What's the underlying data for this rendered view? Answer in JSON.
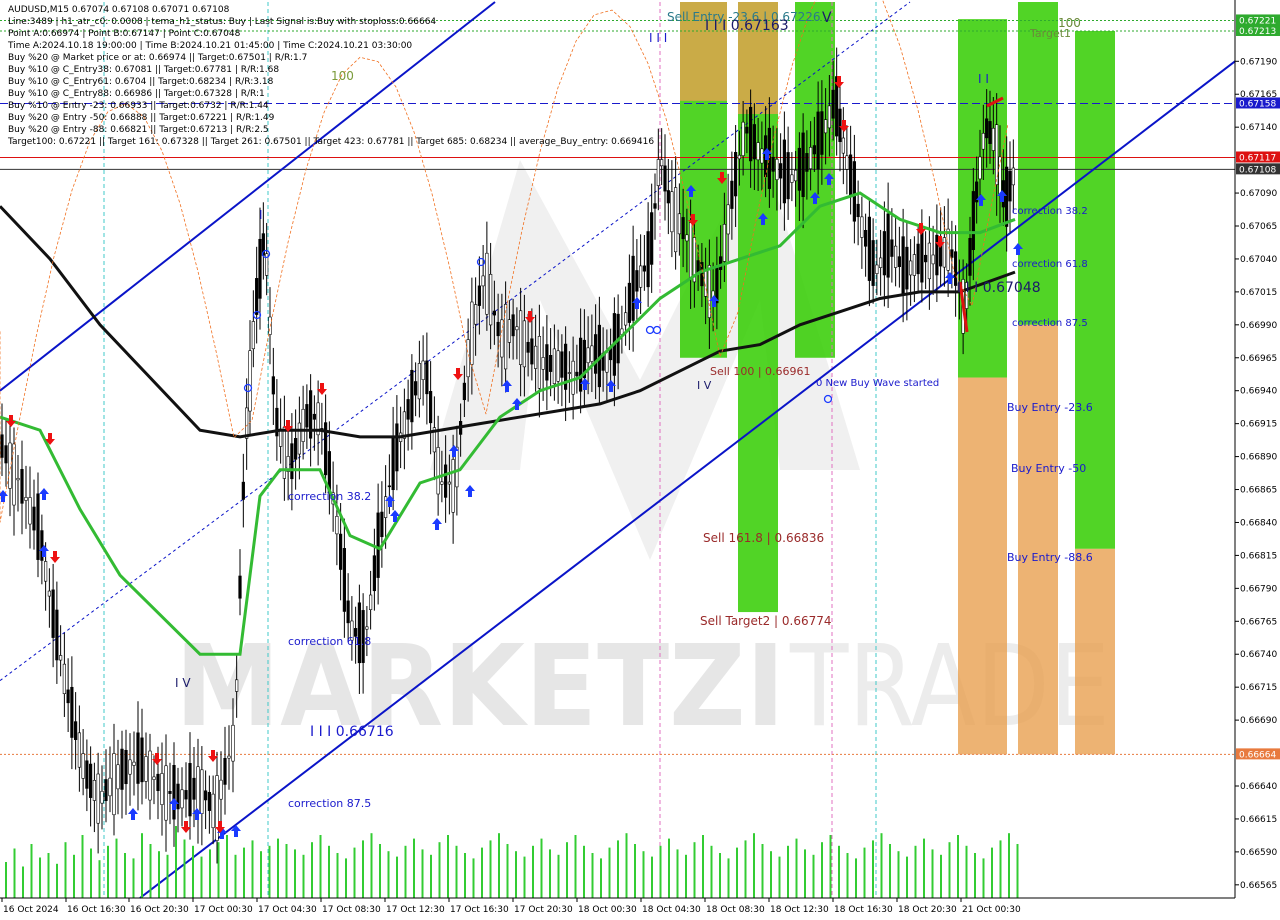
{
  "header": {
    "lines": [
      "AUDUSD,M15  0.67074 0.67108 0.67071 0.67108",
      "Line:3489 | h1_atr_c0: 0.0008 | tema_h1_status: Buy | Last Signal is:Buy with stoploss:0.66664",
      "Point A:0.66974 | Point B:0.67147 | Point C:0.67048",
      "Time A:2024.10.18 19:00:00 | Time B:2024.10.21 01:45:00 | Time C:2024.10.21 03:30:00",
      "Buy %20 @ Market price or at: 0.66974 || Target:0.67501 | R/R:1.7",
      "Buy %10 @ C_Entry38: 0.67081 || Target:0.67781 | R/R:1.68",
      "Buy %10 @ C_Entry61: 0.6704 || Target:0.68234 | R/R:3.18",
      "Buy %10 @ C_Entry88: 0.66986 || Target:0.67328 | R/R:1",
      "Buy %10 @ Entry -23: 0.66933 || Target:0.6732 | R/R:1.44",
      "Buy %20 @ Entry -50: 0.66888 || Target:0.67221 | R/R:1.49",
      "Buy %20 @ Entry -88: 0.66821 || Target:0.67213 | R/R:2.5",
      "Target100: 0.67221 || Target 161: 0.67328 || Target 261: 0.67501 || Target 423: 0.67781 || Target 685: 0.68234 || average_Buy_entry: 0.669416"
    ]
  },
  "axis": {
    "price_ticks": [
      "0.67190",
      "0.67165",
      "0.67140",
      "0.67090",
      "0.67065",
      "0.67040",
      "0.67015",
      "0.66990",
      "0.66965",
      "0.66940",
      "0.66915",
      "0.66890",
      "0.66865",
      "0.66840",
      "0.66815",
      "0.66790",
      "0.66765",
      "0.66740",
      "0.66715",
      "0.66690",
      "0.66640",
      "0.66615",
      "0.66590",
      "0.66565"
    ],
    "price_markers": [
      {
        "text": "0.67221",
        "color": "#2eaa2e"
      },
      {
        "text": "0.67213",
        "color": "#2eaa2e"
      },
      {
        "text": "0.67158",
        "color": "#1a1acc"
      },
      {
        "text": "0.67117",
        "color": "#dd1111"
      },
      {
        "text": "0.67108",
        "color": "#333333"
      },
      {
        "text": "0.66664",
        "color": "#e87a3e"
      }
    ],
    "time_labels": [
      "16 Oct 2024",
      "16 Oct 16:30",
      "16 Oct 20:30",
      "17 Oct 00:30",
      "17 Oct 04:30",
      "17 Oct 08:30",
      "17 Oct 12:30",
      "17 Oct 16:30",
      "17 Oct 20:30",
      "18 Oct 00:30",
      "18 Oct 04:30",
      "18 Oct 08:30",
      "18 Oct 12:30",
      "18 Oct 16:30",
      "18 Oct 20:30",
      "21 Oct 00:30"
    ]
  },
  "annotations": [
    {
      "text": "Sell Entry -23.6 | 0.67226",
      "color": "#2a7a8a"
    },
    {
      "text": "I I I 0.67163",
      "color": "#1a1a6a"
    },
    {
      "text": "Target1",
      "color": "#6a8a3a"
    },
    {
      "text": "100",
      "color": "#7a9a3a"
    },
    {
      "text": "100",
      "color": "#6a8a3a"
    },
    {
      "text": "Sell 100 | 0.66961",
      "color": "#9a2a2a"
    },
    {
      "text": "0 New Buy Wave started",
      "color": "#1a1acc"
    },
    {
      "text": "Sell 161.8 | 0.66836",
      "color": "#9a2a2a"
    },
    {
      "text": "Sell Target2 | 0.66774",
      "color": "#9a2a2a"
    },
    {
      "text": "correction 38.2",
      "color": "#1a1acc"
    },
    {
      "text": "correction 61.8",
      "color": "#1a1acc"
    },
    {
      "text": "correction 87.5",
      "color": "#1a1acc"
    },
    {
      "text": "I I I 0.67048",
      "color": "#1a1a6a"
    },
    {
      "text": "Buy Entry -23.6",
      "color": "#1a1acc"
    },
    {
      "text": "Buy Entry -50",
      "color": "#1a1acc"
    },
    {
      "text": "Buy Entry -88.6",
      "color": "#1a1acc"
    },
    {
      "text": "correction 38.2",
      "color": "#1a1acc"
    },
    {
      "text": "correction 61.8",
      "color": "#1a1acc"
    },
    {
      "text": "correction 87.5",
      "color": "#1a1acc"
    },
    {
      "text": "I I I 0.66716",
      "color": "#1a1acc"
    },
    {
      "text": "I V",
      "color": "#1a1a6a"
    },
    {
      "text": "V",
      "color": "#1a1a6a"
    },
    {
      "text": "I I I",
      "color": "#1a1acc"
    },
    {
      "text": "I V",
      "color": "#1a1a6a"
    },
    {
      "text": "I I",
      "color": "#1a1acc"
    },
    {
      "text": "I",
      "color": "#1a1acc"
    }
  ],
  "watermark": {
    "part1": "MARKETZI",
    "part2": "TRADE"
  },
  "colors": {
    "green_zone": "#33cc00",
    "orange_zone": "#e8a050",
    "channel": "#0a14c8",
    "ma_black": "#111111",
    "ma_green": "#33bb33",
    "volume": "#33cc33",
    "target_line": "#2eaa2e",
    "stop_line": "#e87a3e",
    "bull_candle": "#000000",
    "bear_candle": "#000000"
  },
  "chart_data": {
    "type": "candlestick",
    "symbol": "AUDUSD",
    "timeframe": "M15",
    "last_ohlc": {
      "open": 0.67074,
      "high": 0.67108,
      "low": 0.67071,
      "close": 0.67108
    },
    "ylim": [
      0.66555,
      0.67235
    ],
    "x_labels": [
      "16 Oct 2024",
      "16 Oct 16:30",
      "16 Oct 20:30",
      "17 Oct 00:30",
      "17 Oct 04:30",
      "17 Oct 08:30",
      "17 Oct 12:30",
      "17 Oct 16:30",
      "17 Oct 20:30",
      "18 Oct 00:30",
      "18 Oct 04:30",
      "18 Oct 08:30",
      "18 Oct 12:30",
      "18 Oct 16:30",
      "18 Oct 20:30",
      "21 Oct 00:30"
    ],
    "price_path": [
      [
        0,
        0.669
      ],
      [
        20,
        0.6687
      ],
      [
        40,
        0.6683
      ],
      [
        55,
        0.6676
      ],
      [
        70,
        0.667
      ],
      [
        85,
        0.6665
      ],
      [
        100,
        0.6663
      ],
      [
        120,
        0.6665
      ],
      [
        140,
        0.6666
      ],
      [
        160,
        0.6664
      ],
      [
        180,
        0.6663
      ],
      [
        200,
        0.6664
      ],
      [
        215,
        0.6662
      ],
      [
        235,
        0.6668
      ],
      [
        245,
        0.669
      ],
      [
        255,
        0.67
      ],
      [
        265,
        0.6706
      ],
      [
        275,
        0.6692
      ],
      [
        290,
        0.6688
      ],
      [
        305,
        0.6692
      ],
      [
        320,
        0.6692
      ],
      [
        335,
        0.6685
      ],
      [
        350,
        0.6676
      ],
      [
        365,
        0.6675
      ],
      [
        380,
        0.6683
      ],
      [
        395,
        0.6689
      ],
      [
        410,
        0.6693
      ],
      [
        425,
        0.6696
      ],
      [
        440,
        0.6687
      ],
      [
        455,
        0.6687
      ],
      [
        470,
        0.6698
      ],
      [
        485,
        0.6703
      ],
      [
        500,
        0.6698
      ],
      [
        515,
        0.6699
      ],
      [
        530,
        0.6697
      ],
      [
        545,
        0.6696
      ],
      [
        560,
        0.6696
      ],
      [
        575,
        0.6695
      ],
      [
        590,
        0.6697
      ],
      [
        605,
        0.6696
      ],
      [
        620,
        0.6698
      ],
      [
        635,
        0.6702
      ],
      [
        650,
        0.6704
      ],
      [
        660,
        0.6712
      ],
      [
        670,
        0.6708
      ],
      [
        685,
        0.6706
      ],
      [
        700,
        0.6703
      ],
      [
        715,
        0.6701
      ],
      [
        730,
        0.6708
      ],
      [
        745,
        0.6714
      ],
      [
        760,
        0.6712
      ],
      [
        775,
        0.6711
      ],
      [
        790,
        0.671
      ],
      [
        805,
        0.6711
      ],
      [
        820,
        0.6713
      ],
      [
        835,
        0.6716
      ],
      [
        845,
        0.6712
      ],
      [
        860,
        0.6707
      ],
      [
        875,
        0.6703
      ],
      [
        890,
        0.6705
      ],
      [
        905,
        0.6703
      ],
      [
        920,
        0.6704
      ],
      [
        935,
        0.6704
      ],
      [
        950,
        0.6705
      ],
      [
        965,
        0.67
      ],
      [
        975,
        0.6708
      ],
      [
        985,
        0.6714
      ],
      [
        995,
        0.6713
      ],
      [
        1005,
        0.6708
      ],
      [
        1015,
        0.67108
      ]
    ],
    "moving_averages": [
      {
        "name": "",
        "color": "#111111",
        "points": [
          [
            0,
            0.6708
          ],
          [
            50,
            0.6704
          ],
          [
            100,
            0.6699
          ],
          [
            150,
            0.6695
          ],
          [
            200,
            0.6691
          ],
          [
            240,
            0.66905
          ],
          [
            280,
            0.6691
          ],
          [
            320,
            0.6691
          ],
          [
            360,
            0.66905
          ],
          [
            400,
            0.66905
          ],
          [
            440,
            0.6691
          ],
          [
            480,
            0.66915
          ],
          [
            520,
            0.6692
          ],
          [
            560,
            0.66925
          ],
          [
            600,
            0.6693
          ],
          [
            640,
            0.6694
          ],
          [
            680,
            0.66955
          ],
          [
            720,
            0.6697
          ],
          [
            760,
            0.66975
          ],
          [
            800,
            0.6699
          ],
          [
            840,
            0.67
          ],
          [
            880,
            0.6701
          ],
          [
            920,
            0.67015
          ],
          [
            960,
            0.67015
          ],
          [
            1015,
            0.6703
          ]
        ]
      },
      {
        "name": "",
        "color": "#33bb33",
        "points": [
          [
            0,
            0.6692
          ],
          [
            40,
            0.6691
          ],
          [
            80,
            0.6685
          ],
          [
            120,
            0.668
          ],
          [
            160,
            0.6677
          ],
          [
            200,
            0.6674
          ],
          [
            240,
            0.6674
          ],
          [
            260,
            0.6686
          ],
          [
            280,
            0.6688
          ],
          [
            320,
            0.6688
          ],
          [
            350,
            0.6683
          ],
          [
            380,
            0.6682
          ],
          [
            420,
            0.6687
          ],
          [
            460,
            0.6688
          ],
          [
            500,
            0.6692
          ],
          [
            540,
            0.6694
          ],
          [
            580,
            0.6695
          ],
          [
            620,
            0.6698
          ],
          [
            660,
            0.6701
          ],
          [
            700,
            0.6703
          ],
          [
            740,
            0.6704
          ],
          [
            780,
            0.6705
          ],
          [
            820,
            0.6708
          ],
          [
            860,
            0.6709
          ],
          [
            900,
            0.6707
          ],
          [
            940,
            0.6706
          ],
          [
            980,
            0.6706
          ],
          [
            1015,
            0.6707
          ]
        ]
      }
    ],
    "horizontal_levels": [
      {
        "price": 0.67221,
        "color": "#2eaa2e",
        "style": "dotted"
      },
      {
        "price": 0.67213,
        "color": "#2eaa2e",
        "style": "dotted"
      },
      {
        "price": 0.67158,
        "color": "#1a1acc",
        "style": "dashed"
      },
      {
        "price": 0.67117,
        "color": "#dd1111",
        "style": "solid"
      },
      {
        "price": 0.67108,
        "color": "#333333",
        "style": "solid"
      },
      {
        "price": 0.66664,
        "color": "#e87a3e",
        "style": "dotted"
      }
    ],
    "zones": [
      {
        "from_x": 680,
        "to_x": 727,
        "top": 0.67235,
        "bottom": 0.66965,
        "color": "#33cc00"
      },
      {
        "from_x": 680,
        "to_x": 727,
        "top": 0.67235,
        "bottom": 0.6716,
        "color": "#e8a050"
      },
      {
        "from_x": 738,
        "to_x": 778,
        "top": 0.67235,
        "bottom": 0.66772,
        "color": "#33cc00"
      },
      {
        "from_x": 738,
        "to_x": 778,
        "top": 0.67235,
        "bottom": 0.6715,
        "color": "#e8a050"
      },
      {
        "from_x": 795,
        "to_x": 835,
        "top": 0.67235,
        "bottom": 0.66965,
        "color": "#33cc00"
      },
      {
        "from_x": 958,
        "to_x": 1007,
        "top": 0.67222,
        "bottom": 0.6695,
        "color": "#33cc00"
      },
      {
        "from_x": 958,
        "to_x": 1007,
        "top": 0.6695,
        "bottom": 0.66664,
        "color": "#e8a050"
      },
      {
        "from_x": 1018,
        "to_x": 1058,
        "top": 0.67235,
        "bottom": 0.6699,
        "color": "#33cc00"
      },
      {
        "from_x": 1018,
        "to_x": 1058,
        "top": 0.6699,
        "bottom": 0.66664,
        "color": "#e8a050"
      },
      {
        "from_x": 1075,
        "to_x": 1115,
        "top": 0.67213,
        "bottom": 0.6682,
        "color": "#33cc00"
      },
      {
        "from_x": 1075,
        "to_x": 1115,
        "top": 0.6682,
        "bottom": 0.66664,
        "color": "#e8a050"
      }
    ],
    "channel_lines": [
      {
        "x1": 0,
        "p1": 0.6694,
        "x2": 495,
        "p2": 0.67235
      },
      {
        "x1": 140,
        "p1": 0.66555,
        "x2": 1235,
        "p2": 0.6719
      },
      {
        "x1": 0,
        "p1": 0.6672,
        "x2": 910,
        "p2": 0.67235
      }
    ],
    "volume": [
      40,
      55,
      35,
      60,
      45,
      50,
      38,
      62,
      48,
      70,
      55,
      42,
      58,
      66,
      50,
      44,
      72,
      60,
      52,
      48,
      80,
      65,
      58,
      46,
      54,
      62,
      70,
      48,
      56,
      64,
      52,
      58,
      66,
      60,
      54,
      48,
      62,
      70,
      58,
      50,
      44,
      56,
      64,
      72,
      60,
      52,
      46,
      58,
      66,
      54,
      48,
      62,
      70,
      58,
      50,
      44,
      56,
      64,
      72,
      60,
      52,
      46,
      58,
      66,
      54,
      48,
      62,
      70,
      58,
      50,
      44,
      56,
      64,
      72,
      60,
      52,
      46,
      58,
      66,
      54,
      48,
      62,
      70,
      58,
      50,
      44,
      56,
      64,
      72,
      60,
      52,
      46,
      58,
      66,
      54,
      48,
      62,
      70,
      58,
      50,
      44,
      56,
      64,
      72,
      60,
      52,
      46,
      58,
      66,
      54,
      48,
      62,
      70,
      58,
      50,
      44,
      56,
      64,
      72,
      60
    ]
  }
}
